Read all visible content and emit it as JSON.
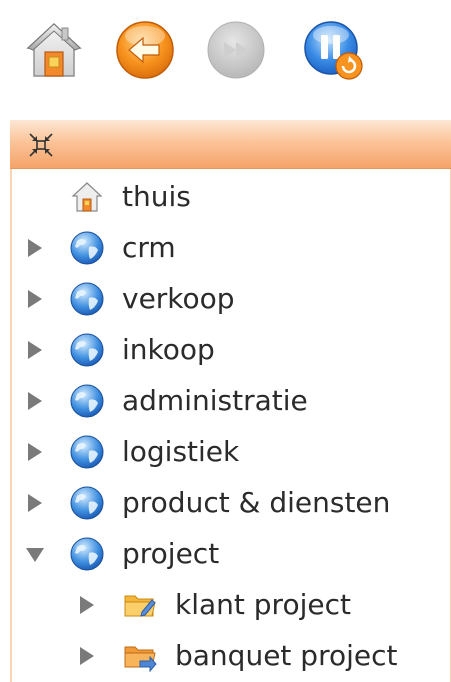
{
  "toolbar": {
    "buttons": [
      {
        "icon": "home-icon"
      },
      {
        "icon": "back-icon"
      },
      {
        "icon": "forward-icon"
      },
      {
        "icon": "pause-refresh-icon"
      }
    ]
  },
  "panel_header": {
    "icon": "collapse-all-icon",
    "accent_color": "#f5a369"
  },
  "tree": {
    "items": [
      {
        "label": "thuis",
        "icon": "home-icon",
        "level": 0,
        "expanded": null
      },
      {
        "label": "crm",
        "icon": "globe-icon",
        "level": 0,
        "expanded": false
      },
      {
        "label": "verkoop",
        "icon": "globe-icon",
        "level": 0,
        "expanded": false
      },
      {
        "label": "inkoop",
        "icon": "globe-icon",
        "level": 0,
        "expanded": false
      },
      {
        "label": "administratie",
        "icon": "globe-icon",
        "level": 0,
        "expanded": false
      },
      {
        "label": "logistiek",
        "icon": "globe-icon",
        "level": 0,
        "expanded": false
      },
      {
        "label": "product & diensten",
        "icon": "globe-icon",
        "level": 0,
        "expanded": false
      },
      {
        "label": "project",
        "icon": "globe-icon",
        "level": 0,
        "expanded": true
      },
      {
        "label": "klant project",
        "icon": "folder-edit-icon",
        "level": 1,
        "expanded": false
      },
      {
        "label": "banquet project",
        "icon": "folder-arrow-icon",
        "level": 1,
        "expanded": false
      }
    ]
  }
}
